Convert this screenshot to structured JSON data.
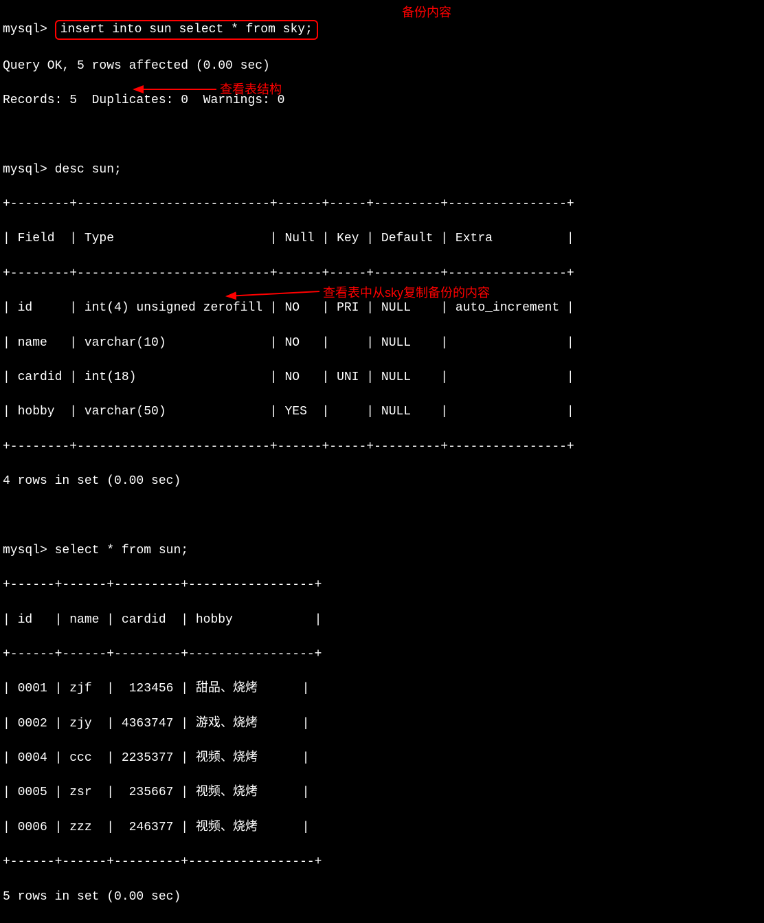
{
  "prompt": "mysql>",
  "commands": {
    "insert": "insert into sun select * from sky;",
    "desc": "desc sun;",
    "select": "select * from sun;"
  },
  "annotations": {
    "backup": "备份内容",
    "structure": "查看表结构",
    "view_content": "查看表中从sky复制备份的内容"
  },
  "results": {
    "insert_ok": "Query OK, 5 rows affected (0.00 sec)",
    "insert_records": "Records: 5  Duplicates: 0  Warnings: 0",
    "desc_footer": "4 rows in set (0.00 sec)",
    "select_footer": "5 rows in set (0.00 sec)"
  },
  "desc_table": {
    "border_top": "+--------+--------------------------+------+-----+---------+----------------+",
    "header": "| Field  | Type                     | Null | Key | Default | Extra          |",
    "border_mid": "+--------+--------------------------+------+-----+---------+----------------+",
    "rows": [
      "| id     | int(4) unsigned zerofill | NO   | PRI | NULL    | auto_increment |",
      "| name   | varchar(10)              | NO   |     | NULL    |                |",
      "| cardid | int(18)                  | NO   | UNI | NULL    |                |",
      "| hobby  | varchar(50)              | YES  |     | NULL    |                |"
    ],
    "border_bot": "+--------+--------------------------+------+-----+---------+----------------+"
  },
  "select_table": {
    "border_top": "+------+------+---------+-----------------+",
    "header": "| id   | name | cardid  | hobby           |",
    "border_mid": "+------+------+---------+-----------------+",
    "rows": [
      "| 0001 | zjf  |  123456 | 甜品、烧烤      |",
      "| 0002 | zjy  | 4363747 | 游戏、烧烤      |",
      "| 0004 | ccc  | 2235377 | 视频、烧烤      |",
      "| 0005 | zsr  |  235667 | 视频、烧烤      |",
      "| 0006 | zzz  |  246377 | 视频、烧烤      |"
    ],
    "border_bot": "+------+------+---------+-----------------+"
  },
  "chart_data": {
    "type": "table",
    "desc_sun": {
      "columns": [
        "Field",
        "Type",
        "Null",
        "Key",
        "Default",
        "Extra"
      ],
      "rows": [
        {
          "Field": "id",
          "Type": "int(4) unsigned zerofill",
          "Null": "NO",
          "Key": "PRI",
          "Default": "NULL",
          "Extra": "auto_increment"
        },
        {
          "Field": "name",
          "Type": "varchar(10)",
          "Null": "NO",
          "Key": "",
          "Default": "NULL",
          "Extra": ""
        },
        {
          "Field": "cardid",
          "Type": "int(18)",
          "Null": "NO",
          "Key": "UNI",
          "Default": "NULL",
          "Extra": ""
        },
        {
          "Field": "hobby",
          "Type": "varchar(50)",
          "Null": "YES",
          "Key": "",
          "Default": "NULL",
          "Extra": ""
        }
      ]
    },
    "select_sun": {
      "columns": [
        "id",
        "name",
        "cardid",
        "hobby"
      ],
      "rows": [
        {
          "id": "0001",
          "name": "zjf",
          "cardid": 123456,
          "hobby": "甜品、烧烤"
        },
        {
          "id": "0002",
          "name": "zjy",
          "cardid": 4363747,
          "hobby": "游戏、烧烤"
        },
        {
          "id": "0004",
          "name": "ccc",
          "cardid": 2235377,
          "hobby": "视频、烧烤"
        },
        {
          "id": "0005",
          "name": "zsr",
          "cardid": 235667,
          "hobby": "视频、烧烤"
        },
        {
          "id": "0006",
          "name": "zzz",
          "cardid": 246377,
          "hobby": "视频、烧烤"
        }
      ]
    }
  }
}
